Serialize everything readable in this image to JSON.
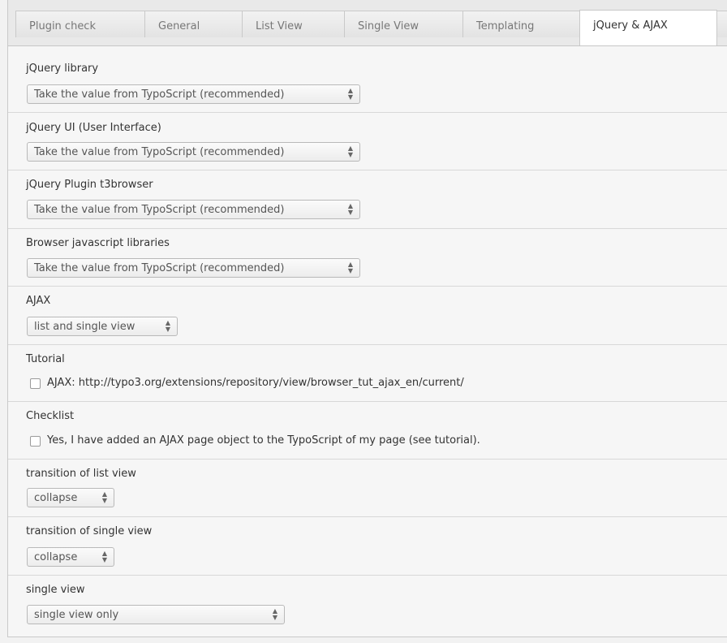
{
  "tabs": [
    "Plugin check",
    "General",
    "List View",
    "Single View",
    "Templating",
    "jQuery & AJAX"
  ],
  "fields": {
    "jquery_library": {
      "label": "jQuery library",
      "value": "Take the value from TypoScript (recommended)"
    },
    "jquery_ui": {
      "label": "jQuery UI (User Interface)",
      "value": "Take the value from TypoScript (recommended)"
    },
    "jquery_plugin": {
      "label": "jQuery Plugin t3browser",
      "value": "Take the value from TypoScript (recommended)"
    },
    "browser_js": {
      "label": "Browser javascript libraries",
      "value": "Take the value from TypoScript (recommended)"
    },
    "ajax": {
      "label": "AJAX",
      "value": "list and single view"
    },
    "tutorial": {
      "label": "Tutorial",
      "checkbox_text": "AJAX: http://typo3.org/extensions/repository/view/browser_tut_ajax_en/current/"
    },
    "checklist": {
      "label": "Checklist",
      "checkbox_text": "Yes, I have added an AJAX page object to the TypoScript of my page (see tutorial)."
    },
    "transition_list": {
      "label": "transition of list view",
      "value": "collapse"
    },
    "transition_single": {
      "label": "transition of single view",
      "value": "collapse"
    },
    "single_view": {
      "label": "single view",
      "value": "single view only"
    }
  }
}
